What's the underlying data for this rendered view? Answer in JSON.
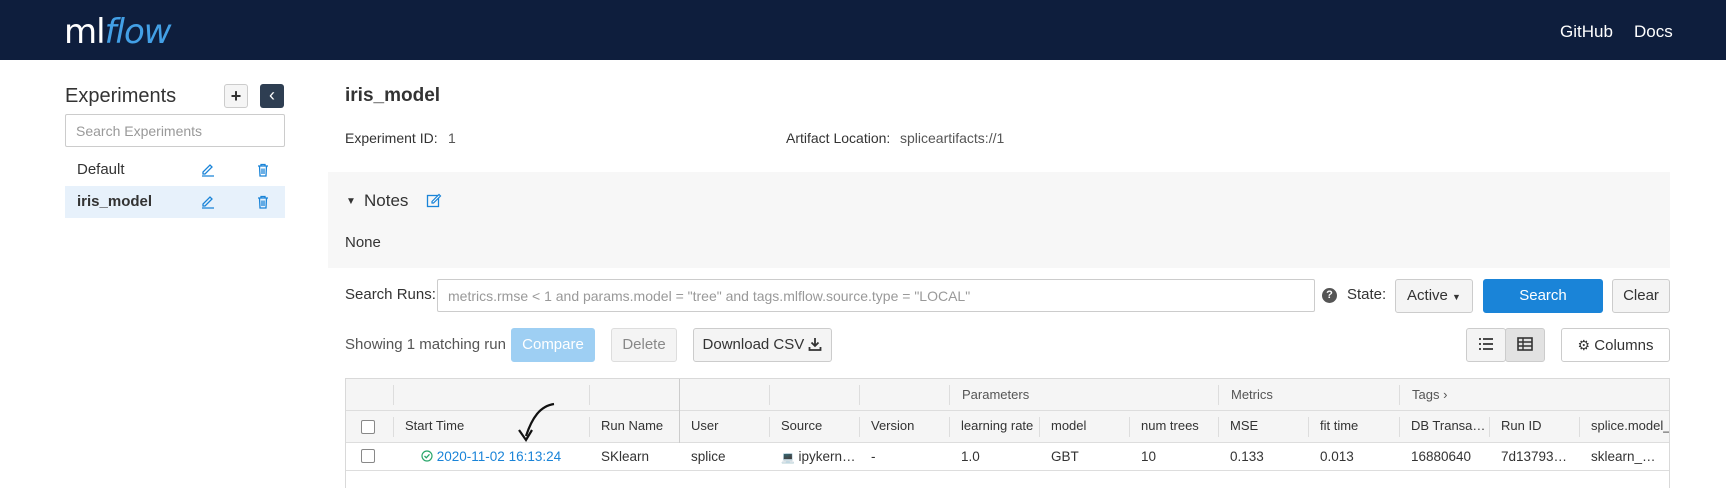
{
  "header": {
    "logo_ml": "ml",
    "logo_flow": "flow",
    "links": [
      "GitHub",
      "Docs"
    ]
  },
  "sidebar": {
    "title": "Experiments",
    "add_label": "+",
    "collapse_label": "‹",
    "search_placeholder": "Search Experiments",
    "items": [
      {
        "label": "Default",
        "active": false
      },
      {
        "label": "iris_model",
        "active": true
      }
    ]
  },
  "experiment": {
    "title": "iris_model",
    "id_label": "Experiment ID:",
    "id_value": "1",
    "artifact_label": "Artifact Location:",
    "artifact_value": "spliceartifacts://1"
  },
  "notes": {
    "title": "Notes",
    "content": "None"
  },
  "search": {
    "label": "Search Runs:",
    "placeholder": "metrics.rmse < 1 and params.model = \"tree\" and tags.mlflow.source.type = \"LOCAL\"",
    "state_label": "State:",
    "state_value": "Active",
    "search_button": "Search",
    "clear_button": "Clear"
  },
  "runs_toolbar": {
    "showing": "Showing 1 matching run",
    "compare": "Compare",
    "delete": "Delete",
    "download": "Download CSV",
    "columns": "Columns"
  },
  "table": {
    "groups": {
      "parameters": "Parameters",
      "metrics": "Metrics",
      "tags": "Tags"
    },
    "columns": [
      "Start Time",
      "Run Name",
      "User",
      "Source",
      "Version",
      "learning rate",
      "model",
      "num trees",
      "MSE",
      "fit time",
      "DB Transaction",
      "Run ID",
      "splice.model_"
    ],
    "rows": [
      {
        "start_time": "2020-11-02 16:13:24",
        "run_name": "SKlearn",
        "user": "splice",
        "source": "ipykernel_l",
        "version": "-",
        "learning_rate": "1.0",
        "model": "GBT",
        "num_trees": "10",
        "mse": "0.133",
        "fit_time": "0.013",
        "db_transaction": "16880640",
        "run_id": "7d13793…",
        "splice_model": "sklearn_…"
      }
    ]
  },
  "colors": {
    "navbar": "#0e1e3d",
    "primary": "#1a84d8",
    "active_item": "#e7f1fb"
  }
}
